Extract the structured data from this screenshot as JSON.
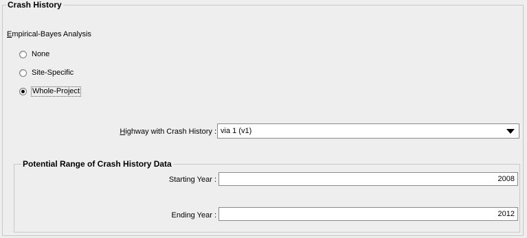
{
  "panel": {
    "title": "Crash History"
  },
  "eb_analysis": {
    "label_first": "E",
    "label_rest": "mpirical-Bayes Analysis",
    "options": [
      {
        "label": "None",
        "selected": false
      },
      {
        "label": "Site-Specific",
        "selected": false
      },
      {
        "label": "Whole-Project",
        "selected": true
      }
    ]
  },
  "highway": {
    "label_first": "H",
    "label_rest": "ighway with Crash History :",
    "selected_value": "via 1 (v1)"
  },
  "range": {
    "title": "Potential Range of Crash History Data",
    "starting_year_label": "Starting Year :",
    "starting_year_value": "2008",
    "ending_year_label": "Ending Year :",
    "ending_year_value": "2012"
  }
}
